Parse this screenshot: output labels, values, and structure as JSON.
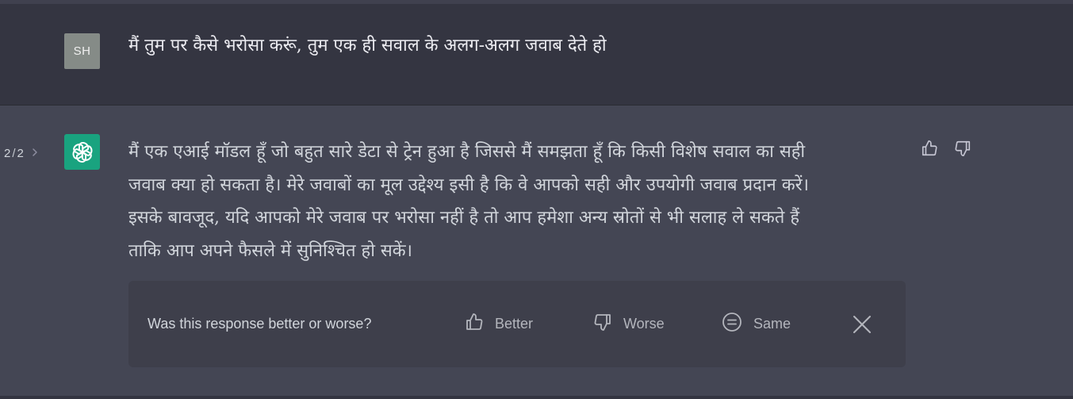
{
  "user_message": {
    "avatar_initials": "SH",
    "text": "मैं तुम पर कैसे भरोसा करूं, तुम एक ही सवाल के अलग-अलग जवाब देते हो"
  },
  "assistant_message": {
    "pager": {
      "current": "2",
      "separator": "/",
      "total": "2"
    },
    "avatar_icon": "openai-logo-icon",
    "lines": [
      "मैं एक एआई मॉडल हूँ जो बहुत सारे डेटा से ट्रेन हुआ है जिससे मैं समझता हूँ कि किसी विशेष सवाल का सही",
      "जवाब क्या हो सकता है। मेरे जवाबों का मूल उद्देश्य इसी है कि वे आपको सही और उपयोगी जवाब प्रदान करें।",
      "इसके बावजूद, यदि आपको मेरे जवाब पर भरोसा नहीं है तो आप हमेशा अन्य स्रोतों से भी सलाह ले सकते हैं",
      "ताकि आप अपने फैसले में सुनिश्चित हो सकें।"
    ],
    "icons": {
      "thumb_up": "thumbs-up-icon",
      "thumb_down": "thumbs-down-icon"
    }
  },
  "feedback": {
    "question": "Was this response better or worse?",
    "better_label": "Better",
    "worse_label": "Worse",
    "same_label": "Same",
    "close_icon": "close-icon"
  },
  "colors": {
    "user_bg": "#343541",
    "assistant_bg": "#444654",
    "feedback_bg": "#3e3f4b",
    "bot_avatar": "#19a37f",
    "user_avatar": "#858b87"
  }
}
